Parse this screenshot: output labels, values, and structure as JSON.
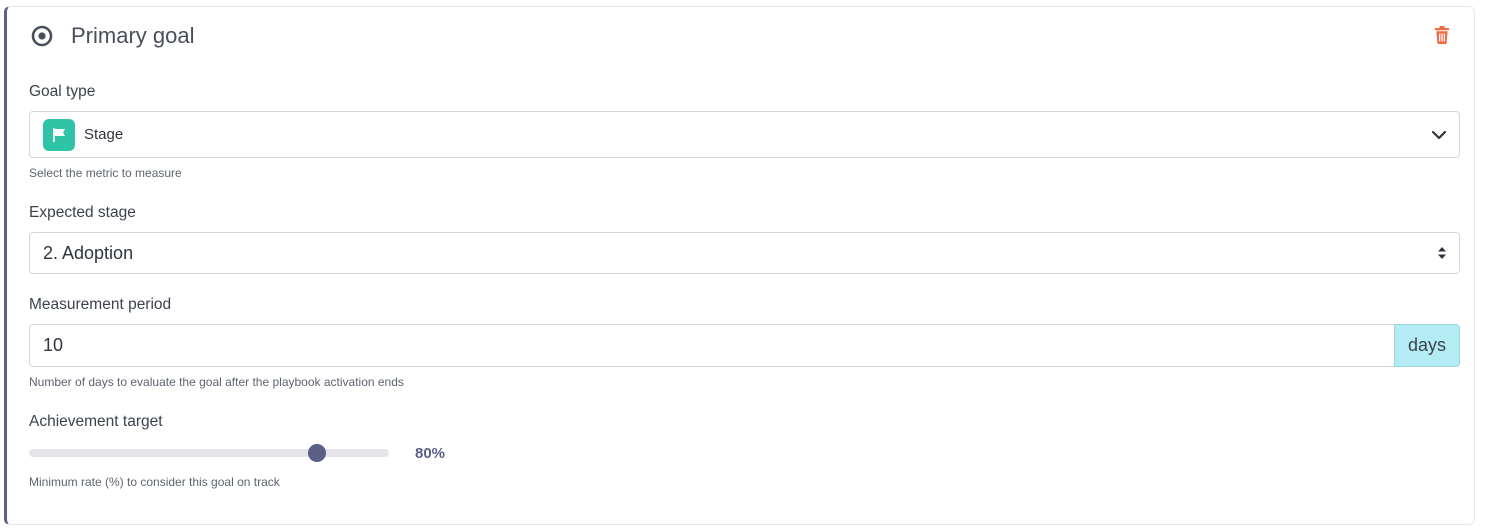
{
  "card": {
    "title": "Primary goal",
    "title_icon": "target-icon",
    "delete_icon": "trash-icon",
    "accent_color": "#5b6088",
    "delete_color": "#f06a43"
  },
  "goal_type": {
    "label": "Goal type",
    "selected": "Stage",
    "selected_icon": "flag-icon",
    "badge_color": "#2ec4a5",
    "help": "Select the metric to measure"
  },
  "expected_stage": {
    "label": "Expected stage",
    "selected": "2. Adoption"
  },
  "measurement_period": {
    "label": "Measurement period",
    "value": "10",
    "unit": "days",
    "help": "Number of days to evaluate the goal after the playbook activation ends"
  },
  "achievement_target": {
    "label": "Achievement target",
    "value_percent": 80,
    "display": "80%",
    "help": "Minimum rate (%) to consider this goal on track"
  }
}
